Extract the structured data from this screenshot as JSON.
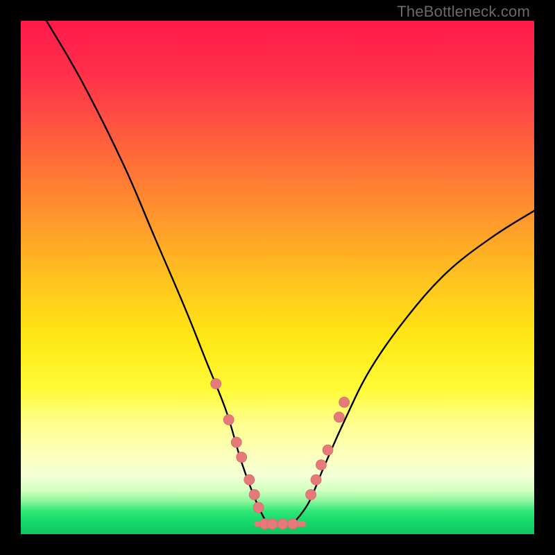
{
  "watermark": "TheBottleneck.com",
  "colors": {
    "black_frame": "#000000",
    "curve": "#000000",
    "marker_fill": "#e67a7a",
    "marker_stroke": "#d86b6b",
    "green_band": "#17e86b"
  },
  "gradient_stops": [
    {
      "offset": 0.0,
      "color": "#ff1a4b"
    },
    {
      "offset": 0.1,
      "color": "#ff2f4a"
    },
    {
      "offset": 0.22,
      "color": "#ff5a3f"
    },
    {
      "offset": 0.35,
      "color": "#ff8a30"
    },
    {
      "offset": 0.5,
      "color": "#ffc220"
    },
    {
      "offset": 0.62,
      "color": "#ffe815"
    },
    {
      "offset": 0.72,
      "color": "#fffb3a"
    },
    {
      "offset": 0.78,
      "color": "#ffff8a"
    },
    {
      "offset": 0.84,
      "color": "#fcffb8"
    },
    {
      "offset": 0.885,
      "color": "#f4ffd6"
    },
    {
      "offset": 0.915,
      "color": "#d2ffbf"
    },
    {
      "offset": 0.935,
      "color": "#8ff79c"
    },
    {
      "offset": 0.955,
      "color": "#2fe877"
    },
    {
      "offset": 0.975,
      "color": "#17d96b"
    },
    {
      "offset": 1.0,
      "color": "#0fc760"
    }
  ],
  "chart_data": {
    "type": "line",
    "title": "",
    "xlabel": "",
    "ylabel": "",
    "xlim": [
      0,
      100
    ],
    "ylim": [
      0,
      100
    ],
    "series": [
      {
        "name": "left-curve",
        "x": [
          5,
          12,
          20,
          26,
          32,
          36,
          40,
          43,
          46,
          48
        ],
        "y": [
          100,
          88,
          72,
          58,
          44,
          34,
          24,
          14,
          6,
          2
        ]
      },
      {
        "name": "right-curve",
        "x": [
          53,
          56,
          59,
          63,
          68,
          75,
          83,
          92,
          100
        ],
        "y": [
          2,
          6,
          13,
          22,
          32,
          42,
          51,
          58,
          63
        ]
      },
      {
        "name": "floor-segment",
        "x": [
          46,
          55
        ],
        "y": [
          2,
          2
        ]
      }
    ],
    "markers": [
      {
        "series": "left-curve",
        "x": 38.0,
        "y": 29.3
      },
      {
        "series": "left-curve",
        "x": 40.5,
        "y": 22.3
      },
      {
        "series": "left-curve",
        "x": 42.0,
        "y": 17.9
      },
      {
        "series": "left-curve",
        "x": 43.0,
        "y": 15.0
      },
      {
        "series": "left-curve",
        "x": 44.5,
        "y": 10.6
      },
      {
        "series": "left-curve",
        "x": 45.5,
        "y": 7.7
      },
      {
        "series": "left-curve",
        "x": 46.3,
        "y": 5.2
      },
      {
        "series": "floor-segment",
        "x": 47.5,
        "y": 2.0
      },
      {
        "series": "floor-segment",
        "x": 49.0,
        "y": 2.0
      },
      {
        "series": "floor-segment",
        "x": 51.0,
        "y": 2.0
      },
      {
        "series": "floor-segment",
        "x": 53.0,
        "y": 2.0
      },
      {
        "series": "right-curve",
        "x": 56.5,
        "y": 7.7
      },
      {
        "series": "right-curve",
        "x": 57.5,
        "y": 10.6
      },
      {
        "series": "right-curve",
        "x": 58.5,
        "y": 13.5
      },
      {
        "series": "right-curve",
        "x": 59.8,
        "y": 16.4
      },
      {
        "series": "right-curve",
        "x": 62.0,
        "y": 22.8
      },
      {
        "series": "right-curve",
        "x": 63.0,
        "y": 25.7
      }
    ]
  }
}
